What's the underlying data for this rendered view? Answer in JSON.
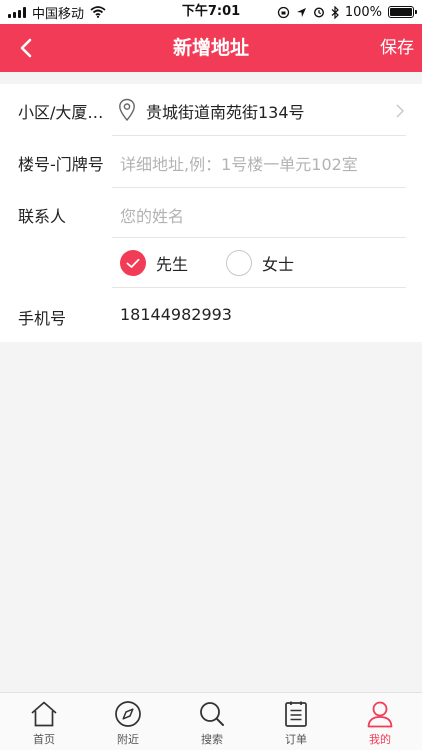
{
  "status_bar": {
    "carrier": "中国移动",
    "time": "下午7:01",
    "battery": "100%",
    "battery_level": 1.0
  },
  "header": {
    "title": "新增地址",
    "save_label": "保存"
  },
  "form": {
    "community": {
      "label": "小区/大厦/学校",
      "value": "贵城街道南苑街134号"
    },
    "building": {
      "label": "楼号-门牌号",
      "placeholder": "详细地址,例：1号楼一单元102室"
    },
    "contact": {
      "label": "联系人",
      "placeholder": "您的姓名"
    },
    "gender": {
      "options": [
        "先生",
        "女士"
      ],
      "selected": "先生"
    },
    "phone": {
      "label": "手机号",
      "value": "18144982993"
    }
  },
  "tabbar": {
    "items": [
      {
        "label": "首页",
        "icon": "home-icon"
      },
      {
        "label": "附近",
        "icon": "compass-icon"
      },
      {
        "label": "搜索",
        "icon": "search-icon"
      },
      {
        "label": "订单",
        "icon": "order-list-icon"
      },
      {
        "label": "我的",
        "icon": "user-icon"
      }
    ],
    "active": "我的"
  },
  "colors": {
    "accent": "#f23c57"
  }
}
